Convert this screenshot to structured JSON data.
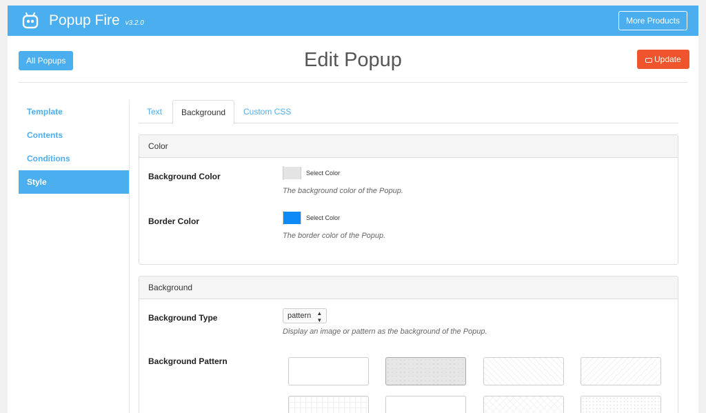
{
  "app": {
    "name": "Popup Fire",
    "version": "v3.2.0",
    "logo_icon": "robot-icon"
  },
  "header": {
    "more_products_label": "More Products"
  },
  "page": {
    "all_popups_label": "All Popups",
    "title": "Edit Popup",
    "update_label": "Update",
    "update_icon": "hdd-icon"
  },
  "sidebar": {
    "items": [
      {
        "label": "Template",
        "active": false
      },
      {
        "label": "Contents",
        "active": false
      },
      {
        "label": "Conditions",
        "active": false
      },
      {
        "label": "Style",
        "active": true
      }
    ]
  },
  "tabs": [
    {
      "label": "Text",
      "active": false
    },
    {
      "label": "Background",
      "active": true
    },
    {
      "label": "Custom CSS",
      "active": false
    }
  ],
  "color_panel": {
    "heading": "Color",
    "background_color": {
      "label": "Background Color",
      "button_label": "Select Color",
      "swatch": "#e4e4e4",
      "help": "The background color of the Popup."
    },
    "border_color": {
      "label": "Border Color",
      "button_label": "Select Color",
      "swatch": "#0d8af8",
      "help": "The border color of the Popup."
    }
  },
  "background_panel": {
    "heading": "Background",
    "type": {
      "label": "Background Type",
      "value": "pattern",
      "help": "Display an image or pattern as the background of the Popup."
    },
    "pattern": {
      "label": "Background Pattern",
      "selected_index": 1
    }
  },
  "colors": {
    "accent": "#4baeee",
    "update": "#f0542d"
  }
}
